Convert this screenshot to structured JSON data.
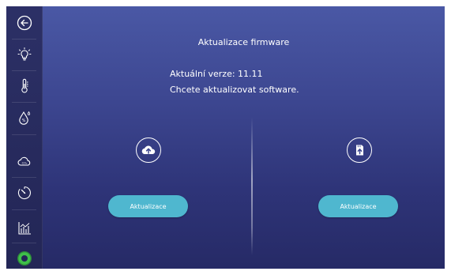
{
  "sidebar": {
    "items": [
      {
        "icon": "exit-icon"
      },
      {
        "icon": "light-icon"
      },
      {
        "icon": "thermometer-icon"
      },
      {
        "icon": "humidity-icon"
      },
      {
        "icon": "co2-cloud-icon"
      },
      {
        "icon": "timer-icon"
      },
      {
        "icon": "chart-icon"
      },
      {
        "icon": "status-ring-icon"
      }
    ],
    "accent": "#3fbf4a"
  },
  "main": {
    "title": "Aktualizace firmware",
    "current_version": "Aktuální verze: 11.11",
    "question": "Chcete aktualizovat software.",
    "left_option": {
      "icon": "cloud-upload-icon",
      "button_label": "Aktualizace"
    },
    "right_option": {
      "icon": "sd-card-upload-icon",
      "button_label": "Aktualizace"
    },
    "button_color": "#4fb7cf"
  }
}
